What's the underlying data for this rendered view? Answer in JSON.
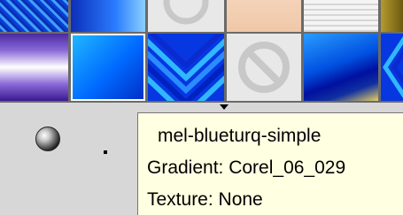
{
  "tooltip": {
    "name": "mel-blueturq-simple",
    "gradient": "Gradient: Corel_06_029",
    "texture": "Texture: None"
  },
  "swatches": [
    {
      "id": "r1c1",
      "icon": "blue-texture"
    },
    {
      "id": "r1c2",
      "icon": "blue-gradient"
    },
    {
      "id": "r1c3",
      "icon": "no-symbol-icon"
    },
    {
      "id": "r1c4",
      "icon": "peach-gradient"
    },
    {
      "id": "r1c5",
      "icon": "white-stripes"
    },
    {
      "id": "r1c6",
      "icon": "gold-gradient"
    },
    {
      "id": "r2c1",
      "icon": "purple-white-gradient"
    },
    {
      "id": "r2c2",
      "icon": "blue-radial-gradient"
    },
    {
      "id": "r2c3",
      "icon": "blue-chevron-pattern"
    },
    {
      "id": "r2c4",
      "icon": "no-symbol-icon"
    },
    {
      "id": "r2c5",
      "icon": "blue-yellow-gradient"
    },
    {
      "id": "r2c6",
      "icon": "blue-chevron-pattern"
    }
  ],
  "colors": {
    "tooltip_bg": "#ffffe1",
    "panel_bg": "#d7d7d7",
    "swatch_border": "#6a6a6a"
  }
}
